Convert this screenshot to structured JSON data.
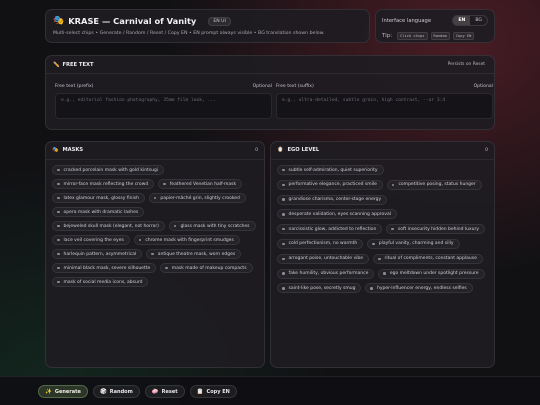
{
  "header": {
    "title": "KRASE — Carnival of Vanity",
    "badge": "EN UI",
    "subtitle": "Multi-select chips • Generate / Random / Reset / Copy EN • EN prompt always visible • BG translation shown below."
  },
  "language": {
    "label": "Interface language",
    "options": [
      "EN",
      "BG"
    ],
    "selected": "EN",
    "tip_label": "Tip:",
    "tips": [
      "Click chips",
      "Random",
      "Copy EN"
    ]
  },
  "free_text": {
    "title": "FREE TEXT",
    "persist_label": "Persists on Reset",
    "prefix": {
      "label": "Free text (prefix)",
      "optional": "Optional",
      "placeholder": "e.g., editorial fashion photography, 35mm film look, ..."
    },
    "suffix": {
      "label": "Free text (suffix)",
      "optional": "Optional",
      "placeholder": "e.g., ultra-detailed, subtle grain, high contrast, --ar 3:4"
    }
  },
  "masks": {
    "title": "MASKS",
    "count": "0",
    "items": [
      "cracked porcelain mask with gold kintsugi",
      "mirror-face mask reflecting the crowd",
      "feathered Venetian half-mask",
      "latex glamour mask, glossy finish",
      "papier-mâché grin, slightly crooked",
      "opera mask with dramatic lashes",
      "bejeweled skull mask (elegant, not horror)",
      "glass mask with tiny scratches",
      "lace veil covering the eyes",
      "chrome mask with fingerprint smudges",
      "harlequin pattern, asymmetrical",
      "antique theatre mask, worn edges",
      "minimal black mask, severe silhouette",
      "mask made of makeup compacts",
      "mask of social media icons, absurd"
    ]
  },
  "ego": {
    "title": "EGO LEVEL",
    "count": "0",
    "items": [
      "subtle self-admiration, quiet superiority",
      "performative elegance, practiced smile",
      "competitive posing, status hunger",
      "grandiose charisma, center-stage energy",
      "desperate validation, eyes scanning approval",
      "narcissistic glow, addicted to reflection",
      "soft insecurity hidden behind luxury",
      "cold perfectionism, no warmth",
      "playful vanity, charming and silly",
      "arrogant poise, untouchable vibe",
      "ritual of compliments, constant applause",
      "fake humility, obvious performance",
      "ego meltdown under spotlight pressure",
      "saint-like pose, secretly smug",
      "hyper-influencer energy, endless selfies"
    ]
  },
  "footer": {
    "generate": "Generate",
    "random": "Random",
    "reset": "Reset",
    "copy": "Copy EN"
  },
  "colors": {
    "background": "#111114",
    "panel": "#1e1c22",
    "primary_button": "#2b3528"
  }
}
